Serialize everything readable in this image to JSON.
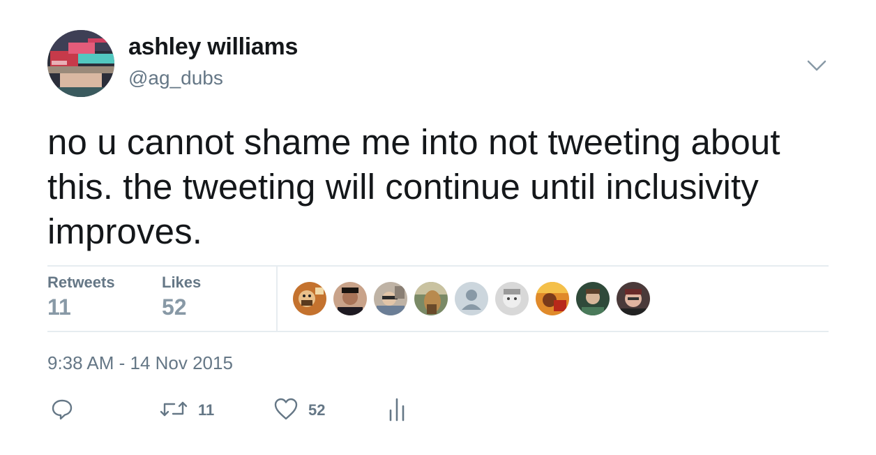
{
  "author": {
    "display_name": "ashley williams",
    "handle": "@ag_dubs"
  },
  "tweet": {
    "text": "no u cannot shame me into not tweeting about this. the tweeting will continue until inclusivity improves."
  },
  "stats": {
    "retweets_label": "Retweets",
    "retweets_count": "11",
    "likes_label": "Likes",
    "likes_count": "52"
  },
  "timestamp": "9:38 AM - 14 Nov 2015",
  "actions": {
    "retweet_count": "11",
    "like_count": "52"
  },
  "icons": {
    "caret": "chevron-down-icon",
    "reply": "reply-icon",
    "retweet": "retweet-icon",
    "like": "heart-icon",
    "analytics": "analytics-icon"
  },
  "colors": {
    "text_primary": "#14171a",
    "text_secondary": "#657786",
    "count_muted": "#8899a6",
    "divider": "#e6ecf0"
  }
}
